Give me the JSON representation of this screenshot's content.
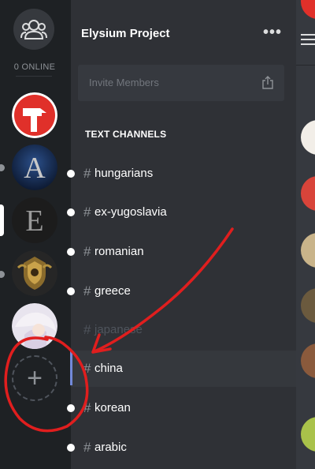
{
  "rail": {
    "online_label": "0 ONLINE",
    "servers": [
      {
        "name": "red-hammer-server",
        "color": "#e0302a"
      },
      {
        "name": "A-server",
        "letter": "A"
      },
      {
        "name": "E-server",
        "letter": "E"
      },
      {
        "name": "crest-server"
      },
      {
        "name": "anime-server"
      }
    ],
    "add_symbol": "+"
  },
  "guild": {
    "name": "Elysium Project",
    "more": "•••",
    "invite_placeholder": "Invite Members"
  },
  "category": "TEXT CHANNELS",
  "channels": [
    {
      "name": "hungarians",
      "unread": true
    },
    {
      "name": "ex-yugoslavia",
      "unread": true
    },
    {
      "name": "romanian",
      "unread": true
    },
    {
      "name": "greece",
      "unread": true
    },
    {
      "name": "japanese",
      "muted": true
    },
    {
      "name": "china",
      "selected": true
    },
    {
      "name": "korean",
      "unread": true
    },
    {
      "name": "arabic",
      "unread": true
    }
  ],
  "hash_symbol": "#",
  "colors": {
    "accent": "#7289da",
    "annotation": "#e01e1e"
  }
}
